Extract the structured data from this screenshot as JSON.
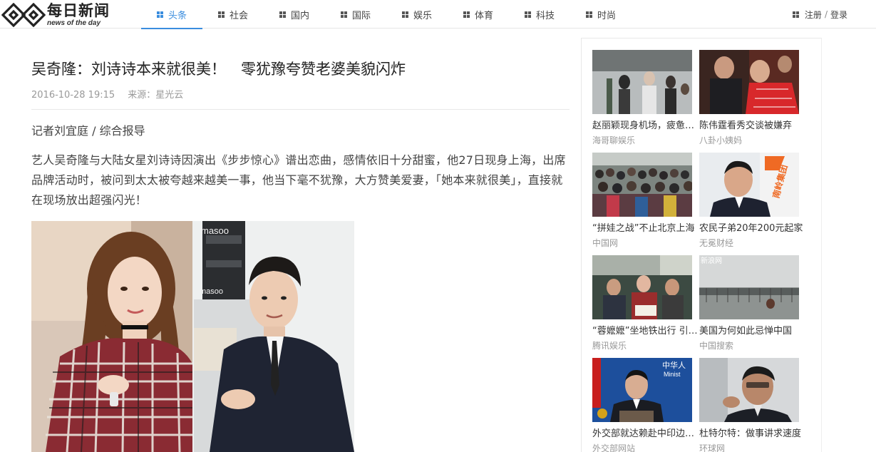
{
  "brand": {
    "name_cn": "每日新闻",
    "name_en": "news of the day"
  },
  "nav": {
    "tabs": [
      {
        "label": "头条",
        "active": true
      },
      {
        "label": "社会",
        "active": false
      },
      {
        "label": "国内",
        "active": false
      },
      {
        "label": "国际",
        "active": false
      },
      {
        "label": "娱乐",
        "active": false
      },
      {
        "label": "体育",
        "active": false
      },
      {
        "label": "科技",
        "active": false
      },
      {
        "label": "时尚",
        "active": false
      }
    ],
    "register_label": "注册",
    "separator": "/",
    "login_label": "登录",
    "icon": "grid-icon"
  },
  "article": {
    "title": "吴奇隆：刘诗诗本来就很美！　零犹豫夸赞老婆美貌闪炸",
    "datetime": "2016-10-28 19:15",
    "source": "来源：星光云",
    "byline": "记者刘宜庭 / 综合报导",
    "body": "艺人吴奇隆与大陆女星刘诗诗因演出《步步惊心》谱出恋曲，感情依旧十分甜蜜，他27日现身上海，出席品牌活动时，被问到太太被夸越来越美一事，他当下毫不犹豫，大方赞美爱妻，「她本来就很美」，直接就在现场放出超强闪光！",
    "photo_text": "masoo"
  },
  "sidebar": {
    "news": [
      {
        "title": "赵丽颖现身机场，疲惫不堪",
        "source": "海哥聊娱乐"
      },
      {
        "title": "陈伟霆看秀交谈被嫌弃",
        "source": "八卦小姨妈"
      },
      {
        "title": "“拼娃之战”不止北京上海",
        "source": "中国网"
      },
      {
        "title": "农民子弟20年200元起家",
        "source": "无冕财经"
      },
      {
        "title": "“蓉嬷嬷”坐地铁出行 引围观",
        "source": "腾讯娱乐"
      },
      {
        "title": "美国为何如此忌惮中国",
        "source": "中国搜索"
      },
      {
        "title": "外交部就达赖赴中印边境表态",
        "source": "外交部网站"
      },
      {
        "title": "杜特尔特：做事讲求速度",
        "source": "环球网"
      }
    ],
    "thumb_texts": {
      "card3": "南岭集团",
      "card5": "新浪网",
      "card6": "中华人",
      "card6_sub": "Minist"
    }
  },
  "colors": {
    "accent": "#3a8dde",
    "text_main": "#333333",
    "text_muted": "#999999",
    "border": "#e8e8e8"
  }
}
